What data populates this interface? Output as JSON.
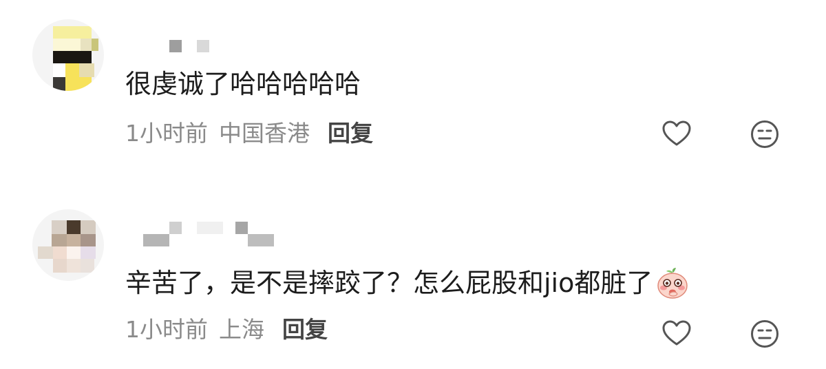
{
  "comments": [
    {
      "text": "很虔诚了哈哈哈哈哈",
      "time": "1小时前",
      "location": "中国香港",
      "reply_label": "回复",
      "like_icon": "heart-outline-icon",
      "dislike_icon": "neutral-face-icon"
    },
    {
      "text": "辛苦了，是不是摔跤了？怎么屁股和jio都脏了",
      "emoji": "peach-blush-emoji-icon",
      "time": "1小时前",
      "location": "上海",
      "reply_label": "回复",
      "like_icon": "heart-outline-icon",
      "dislike_icon": "neutral-face-icon"
    }
  ],
  "colors": {
    "background": "#ffffff",
    "text": "#1c1c1c",
    "meta_gray": "#8a8a8a",
    "reply": "#444444",
    "icon": "#555555"
  }
}
